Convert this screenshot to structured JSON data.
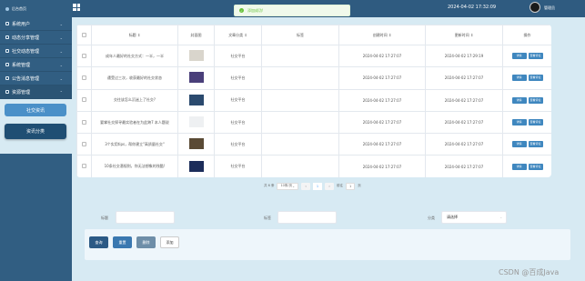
{
  "sidebar": {
    "brand": "后台首页",
    "menu": [
      {
        "label": "系统用户"
      },
      {
        "label": "动态分享管理"
      },
      {
        "label": "社交动态管理"
      },
      {
        "label": "系统管理"
      },
      {
        "label": "公告消息管理"
      },
      {
        "label": "资源管理"
      }
    ],
    "sub_items": [
      "社交资讯",
      "资讯分类"
    ]
  },
  "topbar": {
    "toast": "添加成功!",
    "datetime": "2024-04-02 17:32:09",
    "user": "管理员"
  },
  "table": {
    "headers": [
      "标题",
      "封面图",
      "文章分类",
      "标签",
      "创建时间",
      "更新时间",
      "操作"
    ],
    "rows": [
      {
        "title": "成年人最好的社交方式：一半，一半",
        "category": "社交平台",
        "tags": "",
        "created": "2024-04-02 17:27:07",
        "updated": "2024-04-02 17:29:19",
        "thumb_color": "#d9d5cc"
      },
      {
        "title": "遭受过三次，收获最好的社交状态",
        "category": "社交平台",
        "tags": "",
        "created": "2024-04-02 17:27:07",
        "updated": "2024-04-02 17:27:07",
        "thumb_color": "#4a3f7a"
      },
      {
        "title": "交往该怎么沉迷上了社交?",
        "category": "社交平台",
        "tags": "",
        "created": "2024-04-02 17:27:07",
        "updated": "2024-04-02 17:27:07",
        "thumb_color": "#2b4a6e"
      },
      {
        "title": "要掌社交探寻最实验者在为此跨7 本人题说",
        "category": "社交平台",
        "tags": "",
        "created": "2024-04-02 17:27:07",
        "updated": "2024-04-02 17:27:07",
        "thumb_color": "#eef0f2"
      },
      {
        "title": "3个实用tips，帮你建立\"高质量社交\"",
        "category": "社交平台",
        "tags": "",
        "created": "2024-04-02 17:27:07",
        "updated": "2024-04-02 17:27:07",
        "thumb_color": "#5a4a35"
      },
      {
        "title": "10条社交潜规则，你无法想象的残酷!",
        "category": "社交平台",
        "tags": "",
        "created": "2024-04-02 17:27:07",
        "updated": "2024-04-02 17:27:07",
        "thumb_color": "#1c2d5a"
      }
    ],
    "btn_detail": "详情",
    "btn_edit": "查看评论"
  },
  "pagination": {
    "total": "共 6 条",
    "page_size": "10条/页",
    "current_page": "1",
    "goto_label": "前往",
    "goto_value": "1",
    "page_unit": "页"
  },
  "search": {
    "title_label": "标题",
    "tags_label": "标签",
    "category_label": "分类",
    "category_placeholder": "请选择"
  },
  "actions": {
    "search": "查询",
    "reset": "重置",
    "delete": "删除",
    "add": "添加"
  },
  "watermark": "CSDN @百成Java"
}
